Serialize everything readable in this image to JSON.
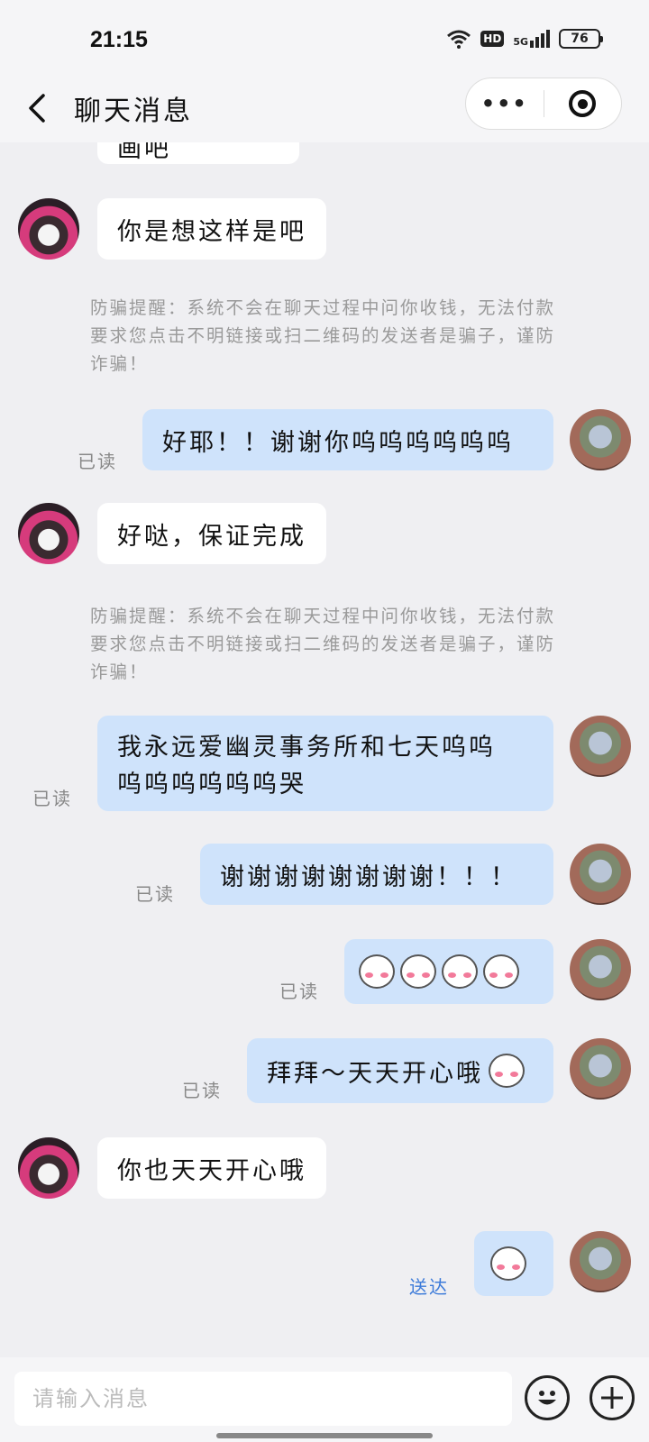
{
  "status": {
    "time": "21:15",
    "network": "5G",
    "hd": "HD",
    "battery": "76"
  },
  "header": {
    "title": "聊天消息",
    "more": "•••"
  },
  "messages": [
    {
      "side": "in",
      "text": "画吧"
    },
    {
      "side": "in",
      "text": "你是想这样是吧"
    },
    {
      "type": "warning",
      "text": "防骗提醒：系统不会在聊天过程中问你收钱，无法付款要求您点击不明链接或扫二维码的发送者是骗子，谨防诈骗！"
    },
    {
      "side": "out",
      "text": "好耶！！谢谢你呜呜呜呜呜呜",
      "status": "已读"
    },
    {
      "side": "in",
      "text": "好哒，保证完成"
    },
    {
      "type": "warning",
      "text": "防骗提醒：系统不会在聊天过程中问你收钱，无法付款要求您点击不明链接或扫二维码的发送者是骗子，谨防诈骗！"
    },
    {
      "side": "out",
      "text_line1": "我永远爱幽灵事务所和七天呜呜",
      "text_line2": "呜呜呜呜呜呜哭",
      "status": "已读"
    },
    {
      "side": "out",
      "text": "谢谢谢谢谢谢谢谢！！！",
      "status": "已读"
    },
    {
      "side": "out",
      "emoji": "blush-face-sticker x4",
      "status": "已读"
    },
    {
      "side": "out",
      "text": "拜拜～天天开心哦",
      "status": "已读"
    },
    {
      "side": "in",
      "text": "你也天天开心哦"
    },
    {
      "side": "out",
      "emoji": "blush-face-sticker",
      "status": "送达"
    }
  ],
  "input": {
    "placeholder": "请输入消息"
  },
  "icons": {
    "back": "chevron-left-icon",
    "close": "record-circle-icon",
    "emoji": "smiley-icon",
    "plus": "plus-circle-icon"
  },
  "colors": {
    "bubble_out": "#cfe3fb",
    "bubble_in": "#ffffff",
    "sent_status": "#3d7bd9"
  }
}
